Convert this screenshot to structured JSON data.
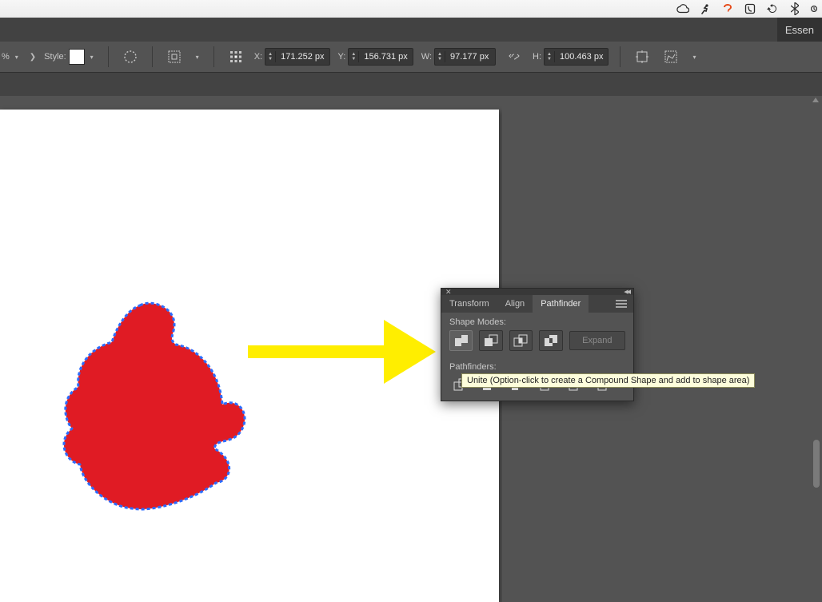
{
  "macbar": {},
  "workspace": {
    "label": "Essen"
  },
  "control": {
    "pct_suffix": "%",
    "style_label": "Style:",
    "x_label": "X:",
    "y_label": "Y:",
    "w_label": "W:",
    "h_label": "H:",
    "x_val": "171.252 px",
    "y_val": "156.731 px",
    "w_val": "97.177 px",
    "h_val": "100.463 px"
  },
  "panel": {
    "tabs": {
      "transform": "Transform",
      "align": "Align",
      "pathfinder": "Pathfinder"
    },
    "shape_modes_label": "Shape Modes:",
    "pathfinders_label": "Pathfinders:",
    "expand_label": "Expand"
  },
  "tooltip": {
    "text": "Unite (Option-click to create a Compound Shape and add to shape area)"
  }
}
